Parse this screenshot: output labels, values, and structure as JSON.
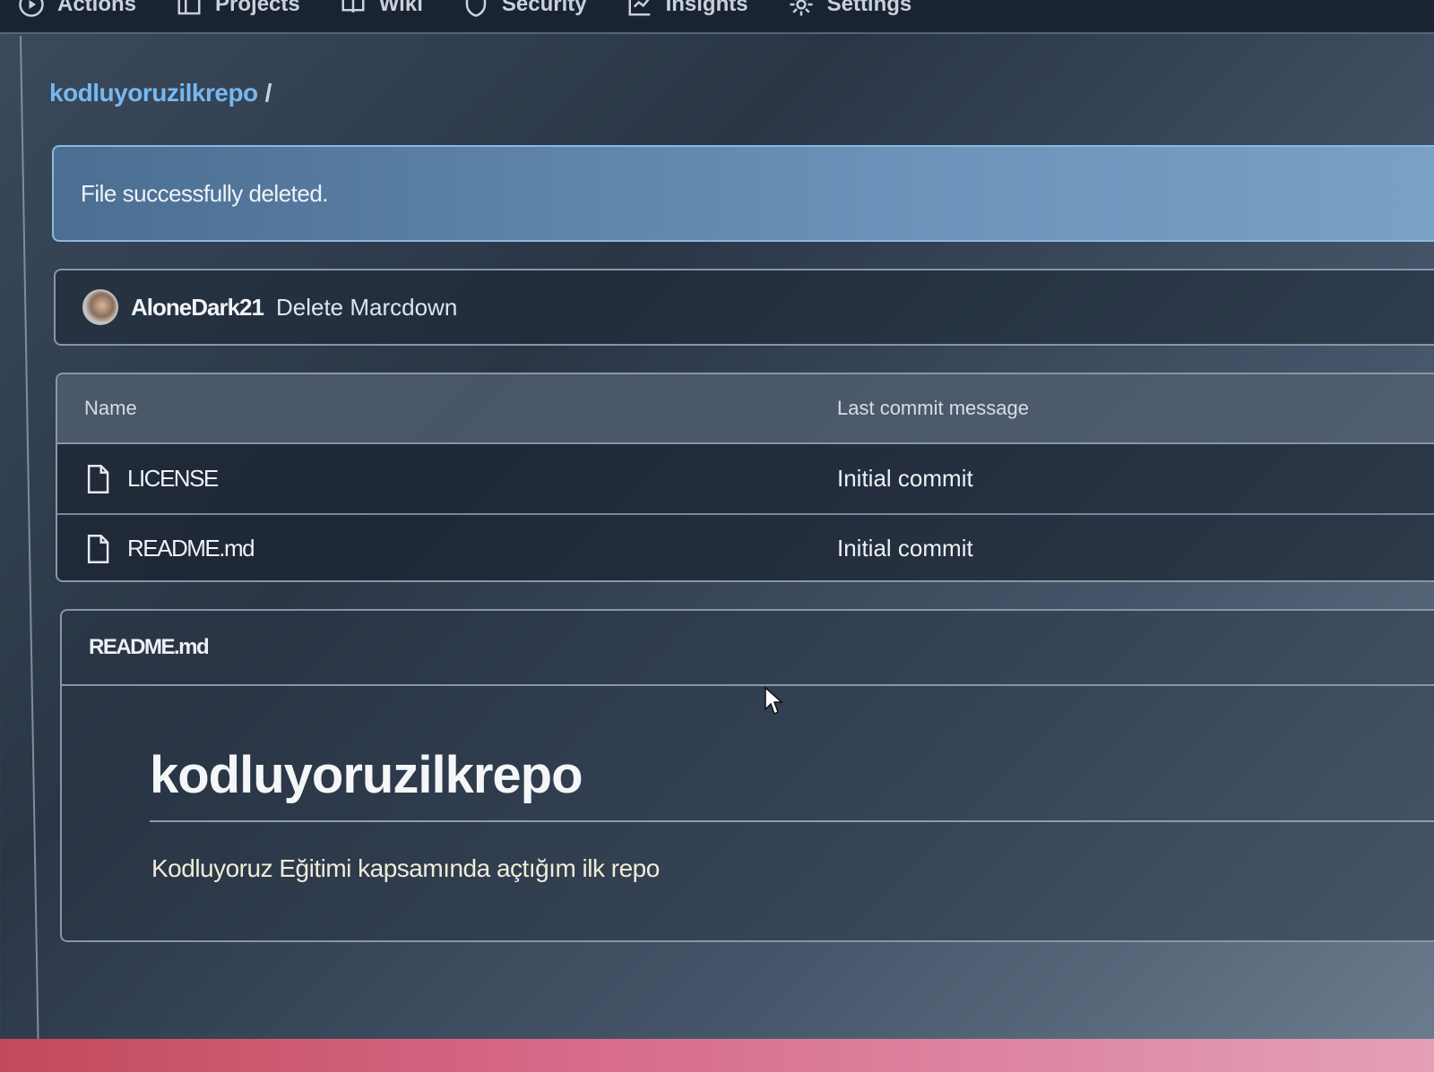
{
  "nav": {
    "items": [
      {
        "label": "Actions",
        "icon": "play-circle-icon"
      },
      {
        "label": "Projects",
        "icon": "table-icon"
      },
      {
        "label": "Wiki",
        "icon": "book-icon"
      },
      {
        "label": "Security",
        "icon": "shield-icon"
      },
      {
        "label": "Insights",
        "icon": "graph-icon"
      },
      {
        "label": "Settings",
        "icon": "gear-icon"
      }
    ]
  },
  "breadcrumb": {
    "repo": "kodluyoruzilkrepo",
    "separator": "/"
  },
  "flash": {
    "message": "File successfully deleted."
  },
  "commit": {
    "author": "AloneDark21",
    "message": "Delete Marcdown"
  },
  "file_table": {
    "headers": {
      "name": "Name",
      "last_commit": "Last commit message"
    },
    "rows": [
      {
        "name": "LICENSE",
        "message": "Initial commit"
      },
      {
        "name": "README.md",
        "message": "Initial commit"
      }
    ]
  },
  "readme": {
    "filename": "README.md",
    "title": "kodluyoruzilkrepo",
    "description": "Kodluyoruz Eğitimi kapsamında açtığım ilk repo"
  },
  "colors": {
    "accent": "#77b8f0",
    "flash_bg": "#6b92b8",
    "header_bg": "#1a2331"
  }
}
